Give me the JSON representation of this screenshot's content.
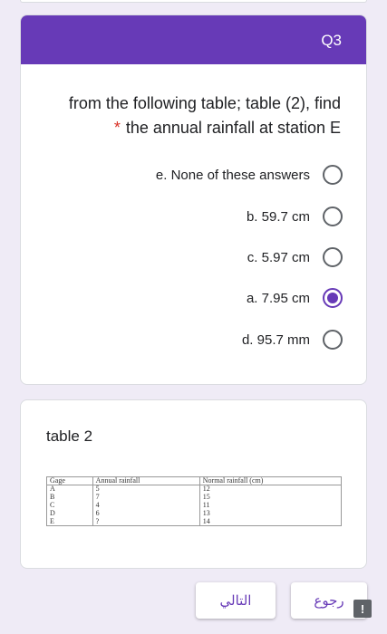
{
  "question": {
    "badge": "Q3",
    "line1": "from the following table; table (2), find",
    "required_mark": "*",
    "line2": "the annual rainfall at station E",
    "options": [
      {
        "label": "e. None of these answers",
        "checked": false
      },
      {
        "label": "b. 59.7 cm",
        "checked": false
      },
      {
        "label": "c. 5.97 cm",
        "checked": false
      },
      {
        "label": "a. 7.95 cm",
        "checked": true
      },
      {
        "label": "d. 95.7 mm",
        "checked": false
      }
    ]
  },
  "table_section": {
    "title": "table 2",
    "headers": [
      "Gage",
      "Annual rainfall",
      "Normal rainfall (cm)"
    ],
    "rows": [
      [
        "A",
        "5",
        "12"
      ],
      [
        "B",
        "7",
        "15"
      ],
      [
        "C",
        "4",
        "11"
      ],
      [
        "D",
        "6",
        "13"
      ],
      [
        "E",
        "?",
        "14"
      ]
    ]
  },
  "nav": {
    "next_label": "التالي",
    "back_label": "رجوع",
    "report_icon": "!"
  }
}
